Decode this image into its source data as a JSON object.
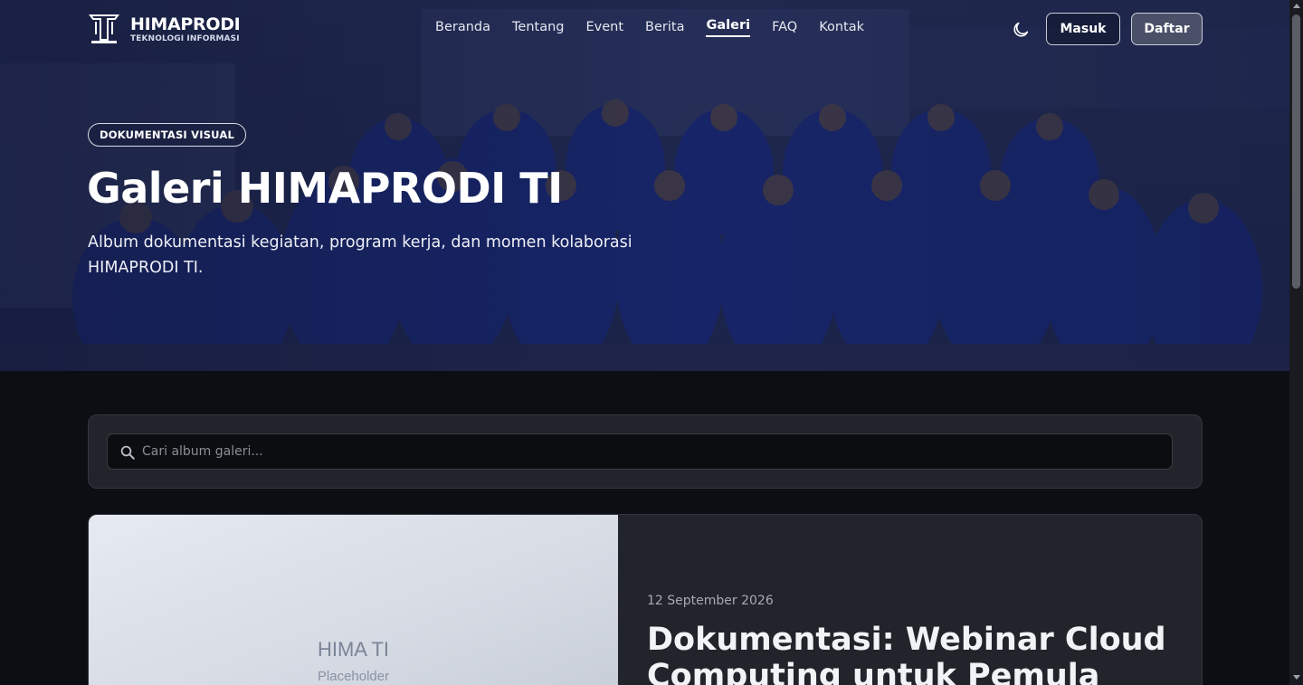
{
  "brand": {
    "title": "HIMAPRODI",
    "subtitle": "TEKNOLOGI INFORMASI"
  },
  "nav": {
    "items": [
      {
        "label": "Beranda",
        "active": false
      },
      {
        "label": "Tentang",
        "active": false
      },
      {
        "label": "Event",
        "active": false
      },
      {
        "label": "Berita",
        "active": false
      },
      {
        "label": "Galeri",
        "active": true
      },
      {
        "label": "FAQ",
        "active": false
      },
      {
        "label": "Kontak",
        "active": false
      }
    ],
    "theme_icon": "moon-icon",
    "login_label": "Masuk",
    "register_label": "Daftar"
  },
  "hero": {
    "badge": "DOKUMENTASI VISUAL",
    "title": "Galeri HIMAPRODI TI",
    "description": "Album dokumentasi kegiatan, program kerja, dan momen kolaborasi HIMAPRODI TI."
  },
  "search": {
    "placeholder": "Cari album galeri...",
    "value": "",
    "icon": "search-icon"
  },
  "albums": [
    {
      "thumbnail_title": "HIMA TI",
      "thumbnail_subtitle": "Placeholder",
      "date": "12 September 2026",
      "title": "Dokumentasi: Webinar Cloud Computing untuk Pemula"
    }
  ],
  "colors": {
    "page_bg": "#0d0e13",
    "card_bg": "#22242b",
    "hero_tint": "#1e2a55",
    "jacket_blue": "#1d3aa6"
  }
}
